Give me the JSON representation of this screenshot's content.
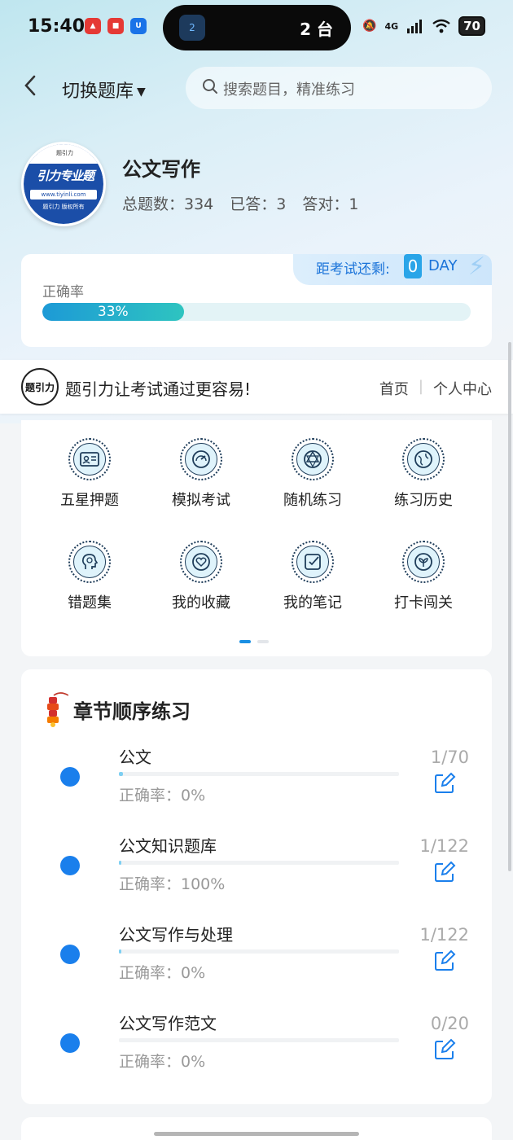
{
  "status_bar": {
    "time": "15:40",
    "island_badge": "2",
    "island_text": "2 台",
    "network": "4G",
    "battery": "70"
  },
  "header": {
    "switch_label": "切换题库",
    "search_placeholder": "搜索题目，精准练习"
  },
  "bank": {
    "logo_brand": "引力专业题",
    "logo_url": "www.tiyinli.com",
    "logo_copyright": "题引力 版权所有",
    "title": "公文写作",
    "total_label": "总题数：334",
    "answered_label": "已答：3",
    "correct_label": "答对：1"
  },
  "accuracy": {
    "exam_label": "距考试还剩:",
    "exam_days": "0",
    "exam_unit": "DAY",
    "label": "正确率",
    "percent_text": "33%",
    "percent": 33
  },
  "banner": {
    "logo_text": "题引力",
    "slogan": "题引力让考试通过更容易!",
    "nav": [
      "首页",
      "个人中心"
    ]
  },
  "functions": [
    {
      "label": "五星押题",
      "icon": "id-card-icon"
    },
    {
      "label": "模拟考试",
      "icon": "speedometer-icon"
    },
    {
      "label": "随机练习",
      "icon": "network-icon"
    },
    {
      "label": "练习历史",
      "icon": "globe-icon"
    },
    {
      "label": "错题集",
      "icon": "head-icon"
    },
    {
      "label": "我的收藏",
      "icon": "heart-icon"
    },
    {
      "label": "我的笔记",
      "icon": "note-check-icon"
    },
    {
      "label": "打卡闯关",
      "icon": "leaf-icon"
    }
  ],
  "chapters": {
    "title": "章节顺序练习",
    "items": [
      {
        "name": "公文",
        "accuracy": "正确率：0%",
        "count": "1/70",
        "progress": 0.014
      },
      {
        "name": "公文知识题库",
        "accuracy": "正确率：100%",
        "count": "1/122",
        "progress": 0.008
      },
      {
        "name": "公文写作与处理",
        "accuracy": "正确率：0%",
        "count": "1/122",
        "progress": 0.008
      },
      {
        "name": "公文写作范文",
        "accuracy": "正确率：0%",
        "count": "0/20",
        "progress": 0
      }
    ]
  },
  "colors": {
    "accent": "#1a7fec",
    "progress_start": "#1d9ad6",
    "progress_end": "#2ec4c0"
  }
}
